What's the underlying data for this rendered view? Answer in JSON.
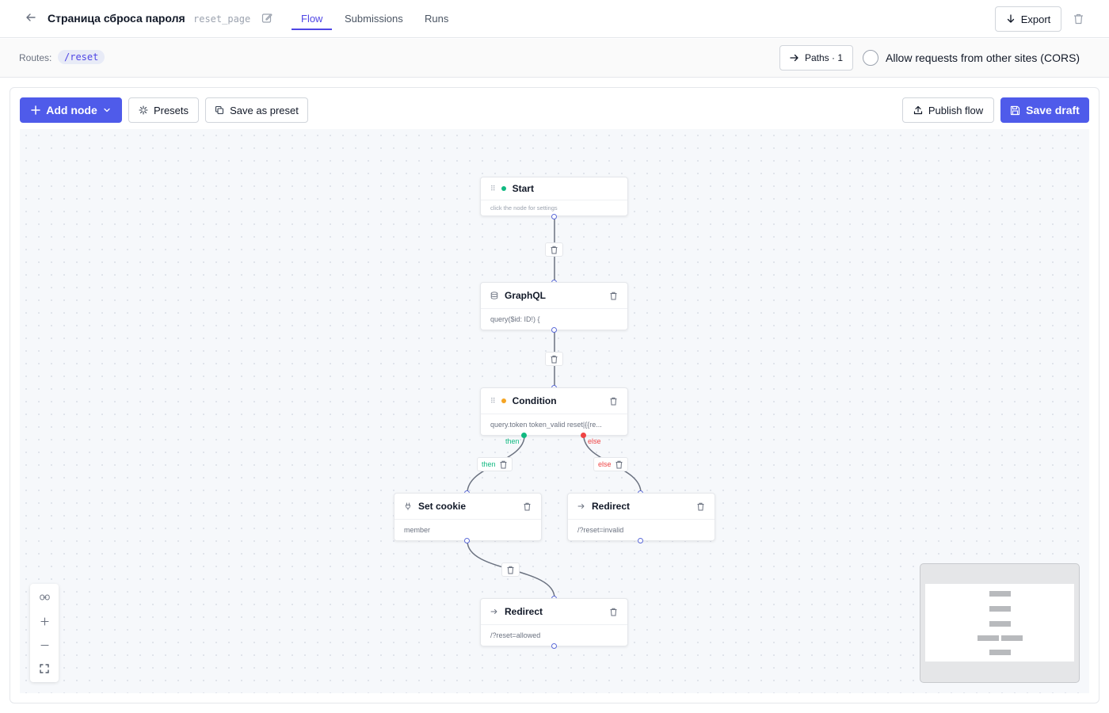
{
  "header": {
    "title": "Страница сброса пароля",
    "slug": "reset_page",
    "tabs": [
      {
        "label": "Flow",
        "active": true
      },
      {
        "label": "Submissions",
        "active": false
      },
      {
        "label": "Runs",
        "active": false
      }
    ],
    "export_label": "Export"
  },
  "routes": {
    "label": "Routes:",
    "items": [
      "/reset"
    ],
    "paths_label": "Paths · 1",
    "cors_label": "Allow requests from other sites (CORS)",
    "cors_enabled": false
  },
  "toolbar": {
    "add_node": "Add node",
    "presets": "Presets",
    "save_as_preset": "Save as preset",
    "publish": "Publish flow",
    "save_draft": "Save draft"
  },
  "nodes": {
    "start": {
      "title": "Start",
      "body": "click the node for settings",
      "status_color": "#10b981",
      "icon": "grip-icon"
    },
    "graphql": {
      "title": "GraphQL",
      "body": "query($id: ID!) {",
      "icon": "database-icon"
    },
    "condition": {
      "title": "Condition",
      "body": "query.token token_valid reset|{{re...",
      "status_color": "#f5a524",
      "icon": "grip-icon"
    },
    "set_cookie": {
      "title": "Set cookie",
      "body": "member",
      "icon": "cookie-icon"
    },
    "redirect_invalid": {
      "title": "Redirect",
      "body": "/?reset=invalid",
      "icon": "arrow-right-icon"
    },
    "redirect_allowed": {
      "title": "Redirect",
      "body": "/?reset=allowed",
      "icon": "arrow-right-icon"
    }
  },
  "edges": {
    "then_label": "then",
    "else_label": "else",
    "then_color": "#10b981",
    "else_color": "#ef4444"
  },
  "colors": {
    "accent": "#4f46e5",
    "primary_button": "#4f5bea",
    "handle": "#5b6ad8"
  }
}
